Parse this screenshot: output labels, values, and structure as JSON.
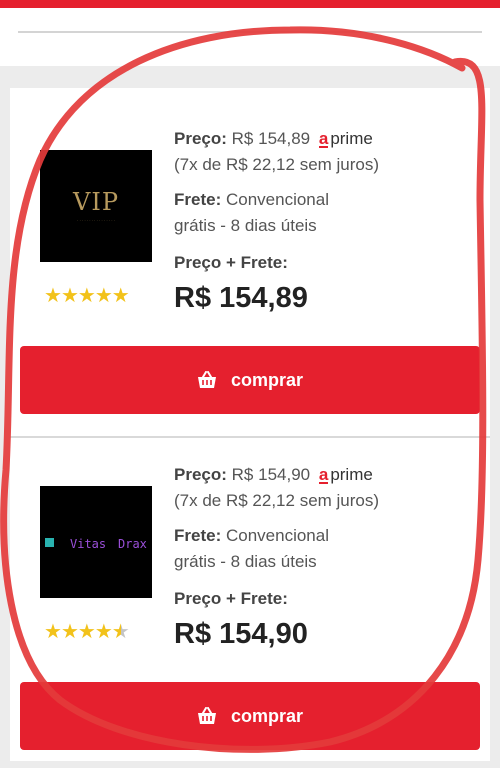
{
  "colors": {
    "accent": "#e5202e",
    "star": "#f2c21a",
    "annotation": "#e43b3b"
  },
  "offers": [
    {
      "price_label": "Preço:",
      "price": "R$ 154,89",
      "prime_badge": "a",
      "prime_text": "prime",
      "installments": "(7x de R$ 22,12 sem juros)",
      "freight_label": "Frete:",
      "freight_type": "Convencional",
      "freight_detail": "grátis - 8 dias úteis",
      "total_label": "Preço + Frete:",
      "total": "R$ 154,89",
      "rating": 5,
      "logo_text": "VIP",
      "buy_label": "comprar"
    },
    {
      "price_label": "Preço:",
      "price": "R$ 154,90",
      "prime_badge": "a",
      "prime_text": "prime",
      "installments": "(7x de R$ 22,12 sem juros)",
      "freight_label": "Frete:",
      "freight_type": "Convencional",
      "freight_detail": "grátis - 8 dias úteis",
      "total_label": "Preço + Frete:",
      "total": "R$ 154,90",
      "rating": 4.5,
      "logo_text_left": "Vitas",
      "logo_text_right": "Drax",
      "buy_label": "comprar"
    }
  ]
}
